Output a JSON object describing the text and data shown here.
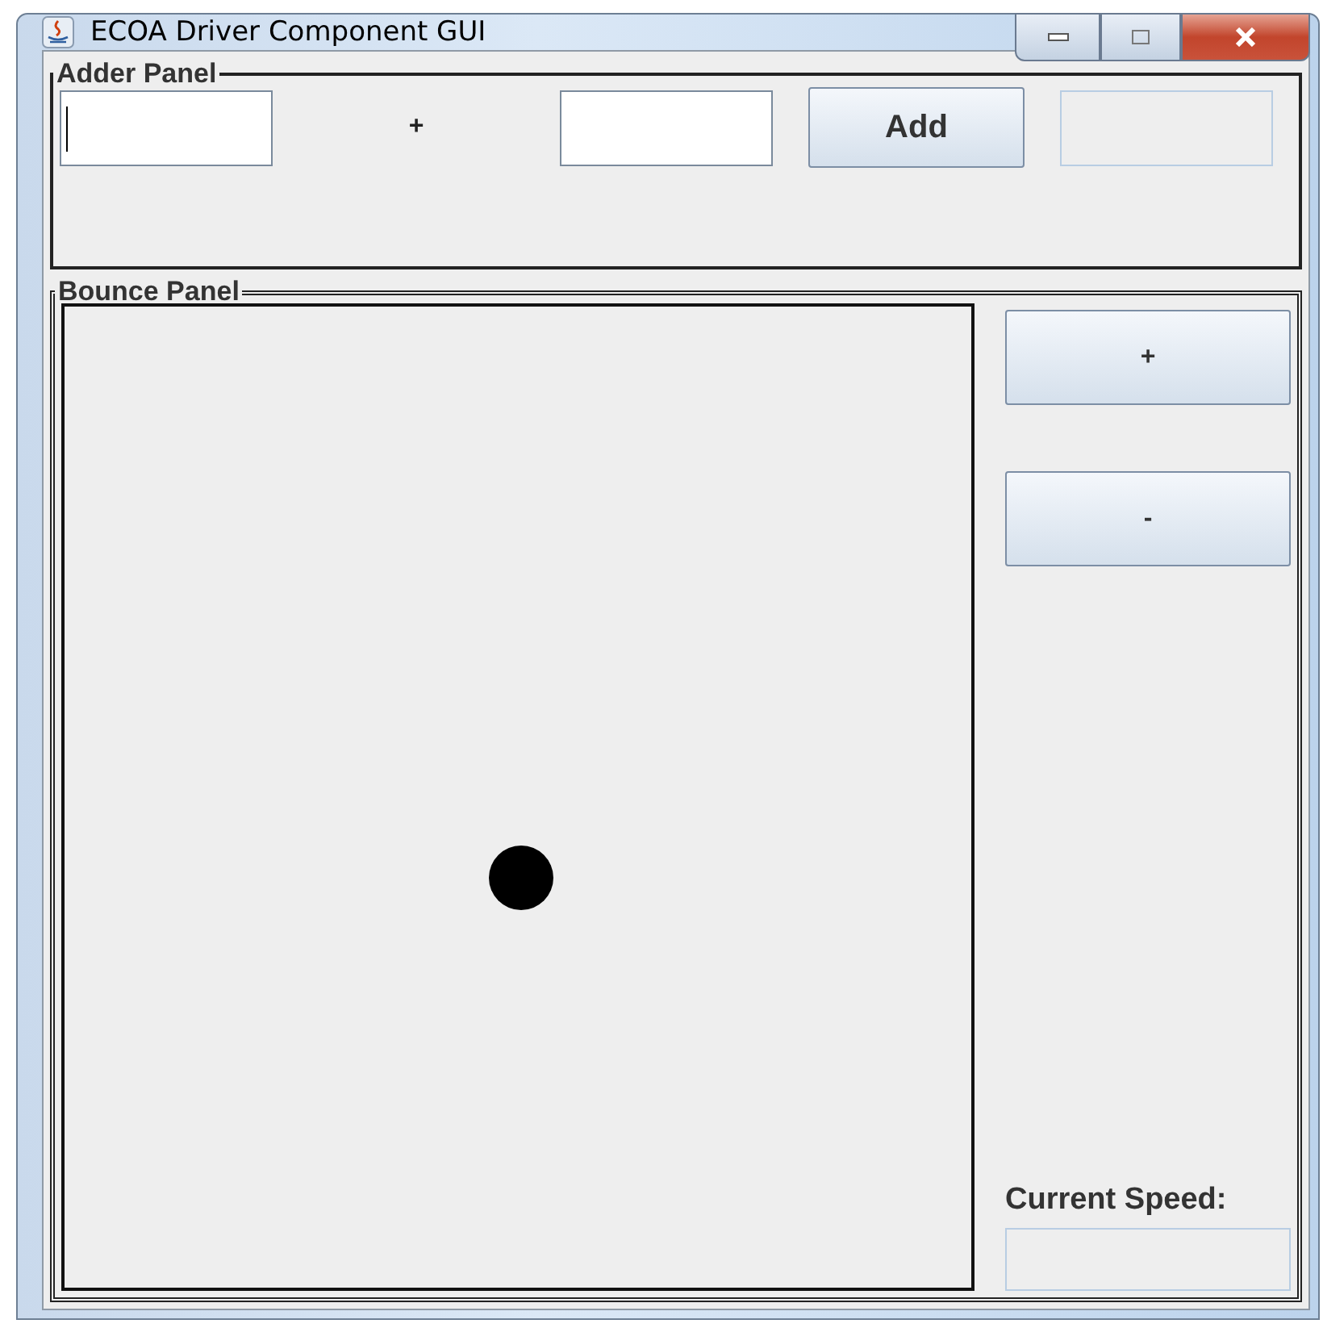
{
  "window": {
    "title": "ECOA Driver Component GUI"
  },
  "adder_panel": {
    "title": "Adder Panel",
    "first_field": {
      "focused": true
    },
    "operator": "+",
    "second_field": {
      "focused": false
    },
    "add_button": "Add",
    "result_field": {
      "disabled": true
    }
  },
  "bounce_panel": {
    "title": "Bounce Panel",
    "buttons": [
      "+",
      "-"
    ],
    "speed_label": "Current Speed:",
    "speed_field": {
      "disabled": true
    }
  }
}
